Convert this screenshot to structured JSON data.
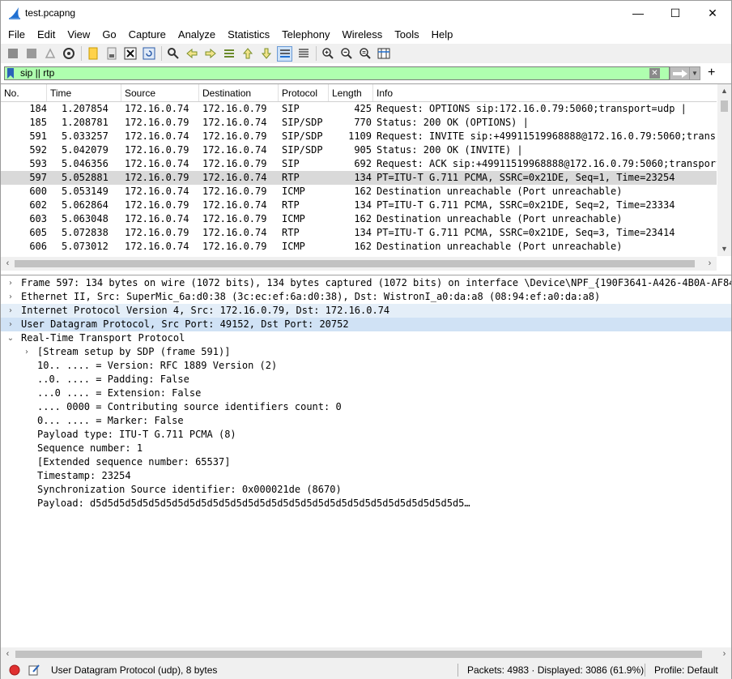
{
  "window": {
    "title": "test.pcapng",
    "controls": {
      "minimize": "—",
      "maximize": "☐",
      "close": "✕"
    }
  },
  "menu": [
    "File",
    "Edit",
    "View",
    "Go",
    "Capture",
    "Analyze",
    "Statistics",
    "Telephony",
    "Wireless",
    "Tools",
    "Help"
  ],
  "toolbar": {
    "icons": [
      "start-capture-icon",
      "stop-capture-icon",
      "restart-capture-icon",
      "capture-options-icon",
      "open-file-icon",
      "save-file-icon",
      "close-file-icon",
      "reload-file-icon",
      "find-packet-icon",
      "go-back-icon",
      "go-forward-icon",
      "go-to-packet-icon",
      "first-packet-icon",
      "last-packet-icon",
      "autoscroll-icon",
      "colorize-icon",
      "zoom-in-icon",
      "zoom-out-icon",
      "normal-size-icon",
      "resize-columns-icon"
    ]
  },
  "filter": {
    "value": "sip || rtp",
    "add": "+"
  },
  "packet_list": {
    "columns": [
      "No.",
      "Time",
      "Source",
      "Destination",
      "Protocol",
      "Length",
      "Info"
    ],
    "rows": [
      {
        "no": "184",
        "time": "1.207854",
        "src": "172.16.0.74",
        "dst": "172.16.0.79",
        "proto": "SIP",
        "len": "425",
        "info": "Request: OPTIONS sip:172.16.0.79:5060;transport=udp  |"
      },
      {
        "no": "185",
        "time": "1.208781",
        "src": "172.16.0.79",
        "dst": "172.16.0.74",
        "proto": "SIP/SDP",
        "len": "770",
        "info": "Status: 200 OK (OPTIONS)  |"
      },
      {
        "no": "591",
        "time": "5.033257",
        "src": "172.16.0.74",
        "dst": "172.16.0.79",
        "proto": "SIP/SDP",
        "len": "1109",
        "info": "Request: INVITE sip:+49911519968888@172.16.0.79:5060;transpo"
      },
      {
        "no": "592",
        "time": "5.042079",
        "src": "172.16.0.79",
        "dst": "172.16.0.74",
        "proto": "SIP/SDP",
        "len": "905",
        "info": "Status: 200 OK (INVITE)  |"
      },
      {
        "no": "593",
        "time": "5.046356",
        "src": "172.16.0.74",
        "dst": "172.16.0.79",
        "proto": "SIP",
        "len": "692",
        "info": "Request: ACK sip:+49911519968888@172.16.0.79:5060;transport="
      },
      {
        "no": "597",
        "time": "5.052881",
        "src": "172.16.0.79",
        "dst": "172.16.0.74",
        "proto": "RTP",
        "len": "134",
        "info": "PT=ITU-T G.711 PCMA, SSRC=0x21DE, Seq=1, Time=23254"
      },
      {
        "no": "600",
        "time": "5.053149",
        "src": "172.16.0.74",
        "dst": "172.16.0.79",
        "proto": "ICMP",
        "len": "162",
        "info": "Destination unreachable (Port unreachable)"
      },
      {
        "no": "602",
        "time": "5.062864",
        "src": "172.16.0.79",
        "dst": "172.16.0.74",
        "proto": "RTP",
        "len": "134",
        "info": "PT=ITU-T G.711 PCMA, SSRC=0x21DE, Seq=2, Time=23334"
      },
      {
        "no": "603",
        "time": "5.063048",
        "src": "172.16.0.74",
        "dst": "172.16.0.79",
        "proto": "ICMP",
        "len": "162",
        "info": "Destination unreachable (Port unreachable)"
      },
      {
        "no": "605",
        "time": "5.072838",
        "src": "172.16.0.79",
        "dst": "172.16.0.74",
        "proto": "RTP",
        "len": "134",
        "info": "PT=ITU-T G.711 PCMA, SSRC=0x21DE, Seq=3, Time=23414"
      },
      {
        "no": "606",
        "time": "5.073012",
        "src": "172.16.0.74",
        "dst": "172.16.0.79",
        "proto": "ICMP",
        "len": "162",
        "info": "Destination unreachable (Port unreachable)"
      }
    ],
    "selected_index": 5
  },
  "details": {
    "rows": [
      {
        "twisty": "›",
        "text": "Frame 597: 134 bytes on wire (1072 bits), 134 bytes captured (1072 bits) on interface \\Device\\NPF_{190F3641-A426-4B0A-AF84-CD9",
        "indent": 0,
        "hl": ""
      },
      {
        "twisty": "›",
        "text": "Ethernet II, Src: SuperMic_6a:d0:38 (3c:ec:ef:6a:d0:38), Dst: WistronI_a0:da:a8 (08:94:ef:a0:da:a8)",
        "indent": 0,
        "hl": ""
      },
      {
        "twisty": "›",
        "text": "Internet Protocol Version 4, Src: 172.16.0.79, Dst: 172.16.0.74",
        "indent": 0,
        "hl": "hl1"
      },
      {
        "twisty": "›",
        "text": "User Datagram Protocol, Src Port: 49152, Dst Port: 20752",
        "indent": 0,
        "hl": "hl2"
      },
      {
        "twisty": "⌄",
        "text": "Real-Time Transport Protocol",
        "indent": 0,
        "hl": ""
      },
      {
        "twisty": "›",
        "text": "[Stream setup by SDP (frame 591)]",
        "indent": 1,
        "hl": ""
      },
      {
        "twisty": "",
        "text": "10.. .... = Version: RFC 1889 Version (2)",
        "indent": 1,
        "hl": ""
      },
      {
        "twisty": "",
        "text": "..0. .... = Padding: False",
        "indent": 1,
        "hl": ""
      },
      {
        "twisty": "",
        "text": "...0 .... = Extension: False",
        "indent": 1,
        "hl": ""
      },
      {
        "twisty": "",
        "text": ".... 0000 = Contributing source identifiers count: 0",
        "indent": 1,
        "hl": ""
      },
      {
        "twisty": "",
        "text": "0... .... = Marker: False",
        "indent": 1,
        "hl": ""
      },
      {
        "twisty": "",
        "text": "Payload type: ITU-T G.711 PCMA (8)",
        "indent": 1,
        "hl": ""
      },
      {
        "twisty": "",
        "text": "Sequence number: 1",
        "indent": 1,
        "hl": ""
      },
      {
        "twisty": "",
        "text": "[Extended sequence number: 65537]",
        "indent": 1,
        "hl": ""
      },
      {
        "twisty": "",
        "text": "Timestamp: 23254",
        "indent": 1,
        "hl": ""
      },
      {
        "twisty": "",
        "text": "Synchronization Source identifier: 0x000021de (8670)",
        "indent": 1,
        "hl": ""
      },
      {
        "twisty": "",
        "text": "Payload: d5d5d5d5d5d5d5d5d5d5d5d5d5d5d5d5d5d5d5d5d5d5d5d5d5d5d5d5d5d5d5d5…",
        "indent": 1,
        "hl": ""
      }
    ]
  },
  "status": {
    "field": "User Datagram Protocol (udp), 8 bytes",
    "packets": "Packets: 4983 · Displayed: 3086 (61.9%)",
    "profile": "Profile: Default"
  },
  "colors": {
    "filter_ok": "#afffaf",
    "selected_row": "#d9d9d9",
    "highlight1": "#e4eef8",
    "highlight2": "#d0e2f5"
  }
}
